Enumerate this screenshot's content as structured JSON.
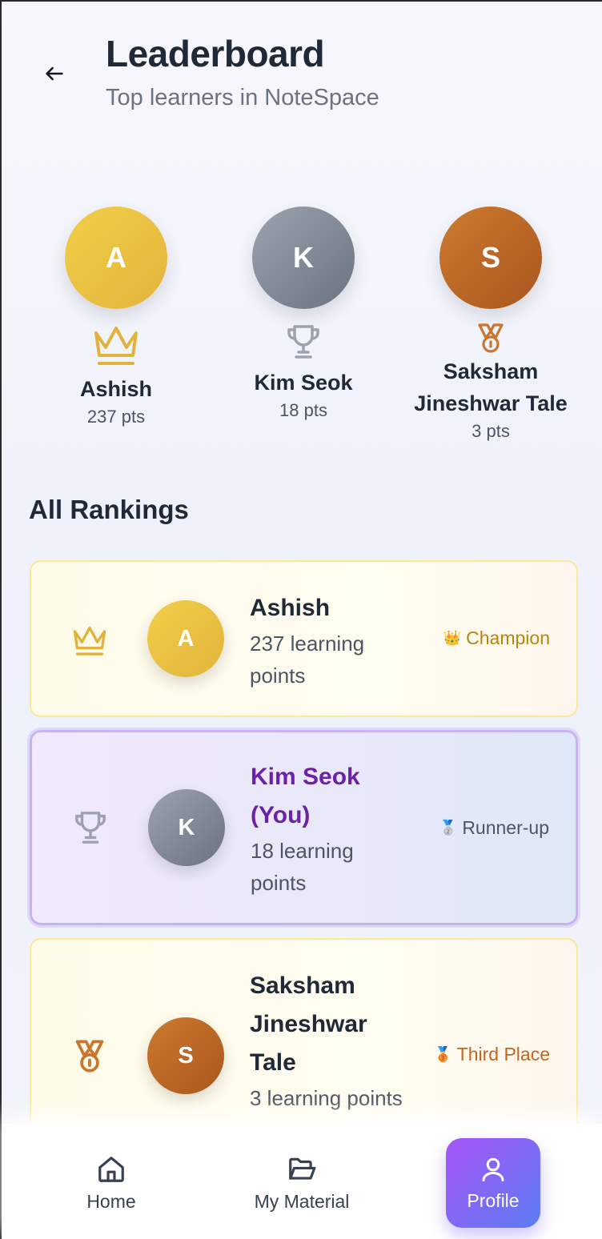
{
  "header": {
    "title": "Leaderboard",
    "subtitle": "Top learners in NoteSpace"
  },
  "podium": [
    {
      "rank": 1,
      "initial": "A",
      "name": "Ashish",
      "points": "237 pts",
      "icon": "crown-icon",
      "color": "#e9c042"
    },
    {
      "rank": 2,
      "initial": "K",
      "name": "Kim Seok",
      "points": "18 pts",
      "icon": "trophy-icon",
      "color": "#9ca3af"
    },
    {
      "rank": 3,
      "initial": "S",
      "name": "Saksham Jineshwar Tale",
      "points": "3 pts",
      "icon": "medal-icon",
      "color": "#c4732e"
    }
  ],
  "rankings_title": "All Rankings",
  "rankings": [
    {
      "initial": "A",
      "name": "Ashish",
      "points": "237 learning points",
      "badge_emoji": "👑",
      "badge": "Champion",
      "badge_color": "#b8860b",
      "icon": "crown-icon"
    },
    {
      "initial": "K",
      "name": "Kim Seok (You)",
      "points": "18 learning points",
      "badge_emoji": "🥈",
      "badge": "Runner-up",
      "badge_color": "#4b5563",
      "icon": "trophy-icon"
    },
    {
      "initial": "S",
      "name": "Saksham Jineshwar Tale",
      "points": "3 learning points",
      "badge_emoji": "🥉",
      "badge": "Third Place",
      "badge_color": "#c2661f",
      "icon": "medal-icon"
    }
  ],
  "nav": {
    "home": "Home",
    "material": "My Material",
    "profile": "Profile"
  }
}
